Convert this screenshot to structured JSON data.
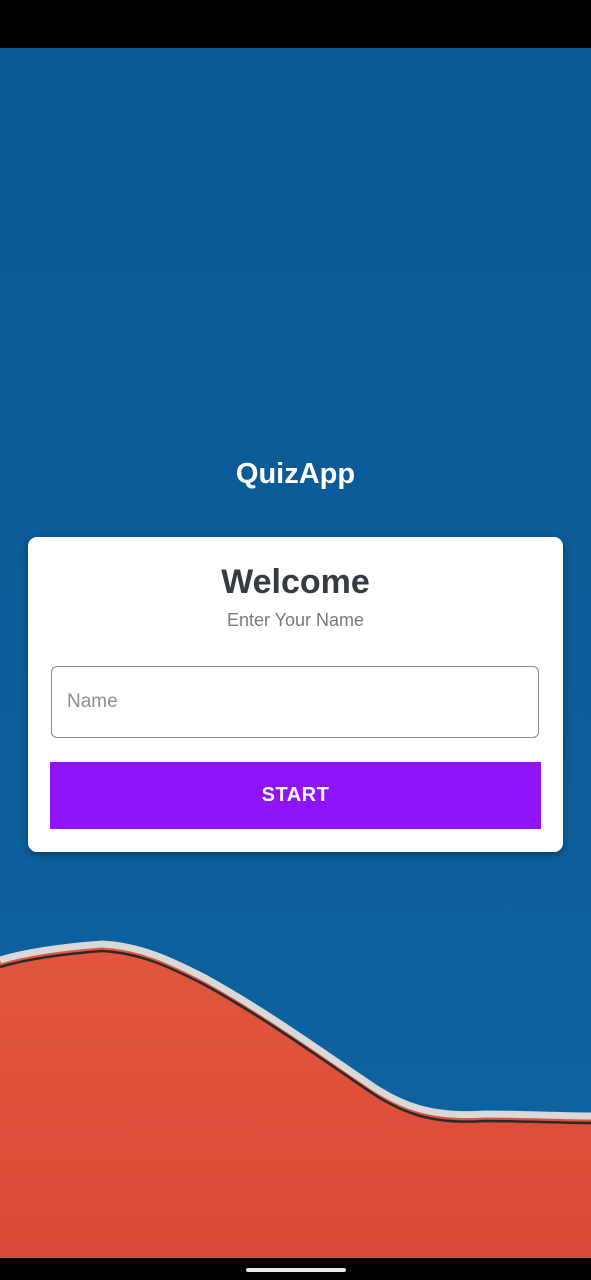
{
  "app": {
    "title": "QuizApp"
  },
  "card": {
    "heading": "Welcome",
    "subheading": "Enter Your Name",
    "name_input": {
      "placeholder": "Name",
      "value": ""
    },
    "start_button_label": "START"
  },
  "colors": {
    "background_sky": "#0a5b97",
    "background_wall": "#e0523c",
    "card": "#ffffff",
    "heading_text": "#363a43",
    "button": "#8f14fb",
    "button_text": "#ffffff"
  },
  "icons": {
    "home_indicator": "home-indicator-bar"
  }
}
